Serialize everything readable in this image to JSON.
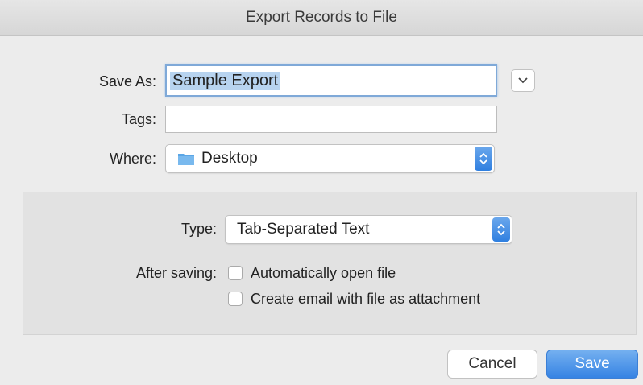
{
  "window": {
    "title": "Export Records to File"
  },
  "form": {
    "save_as_label": "Save As:",
    "save_as_value": "Sample Export",
    "tags_label": "Tags:",
    "tags_value": "",
    "where_label": "Where:",
    "where_value": "Desktop"
  },
  "options": {
    "type_label": "Type:",
    "type_value": "Tab-Separated Text",
    "after_saving_label": "After saving:",
    "checkboxes": [
      {
        "label": "Automatically open file",
        "checked": false
      },
      {
        "label": "Create email with file as attachment",
        "checked": false
      }
    ]
  },
  "buttons": {
    "cancel": "Cancel",
    "save": "Save"
  },
  "colors": {
    "accent": "#3683e3",
    "selection": "#b7d3ef",
    "folder": "#5aa6e6"
  }
}
